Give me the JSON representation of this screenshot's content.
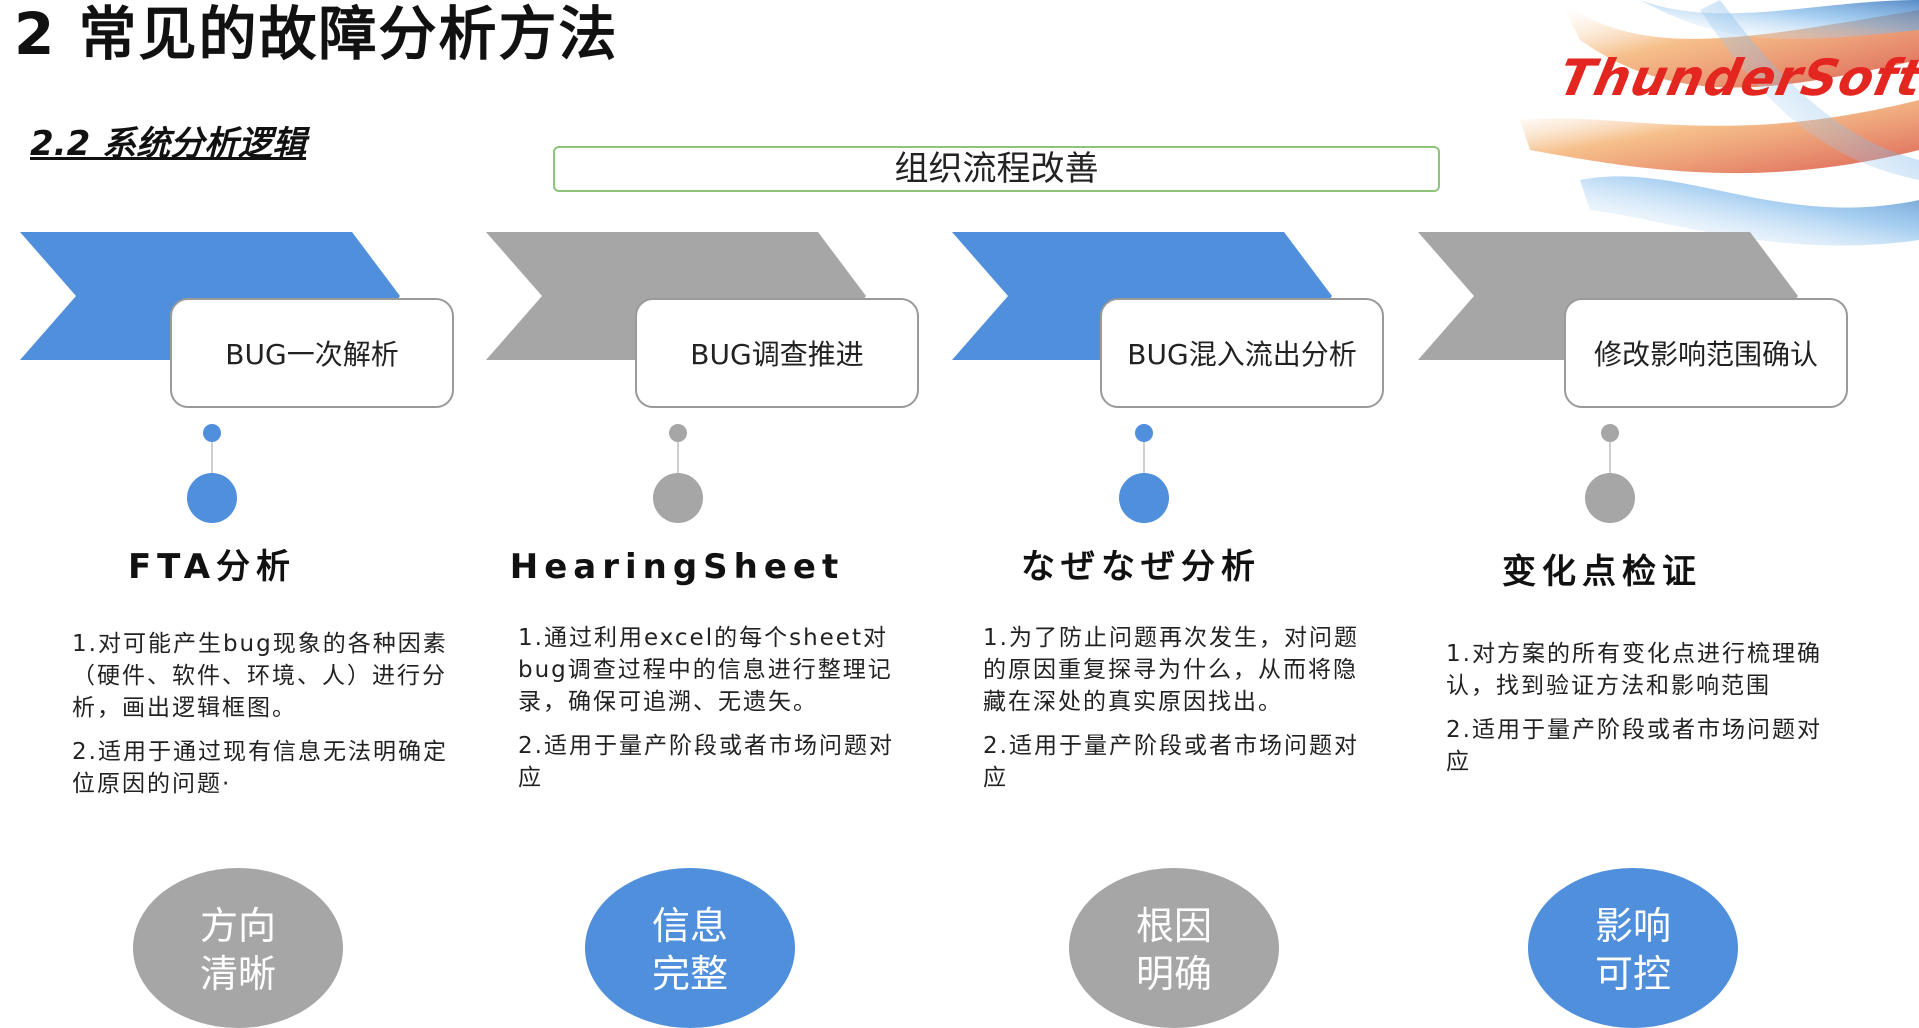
{
  "slide": {
    "title": "2  常见的故障分析方法",
    "subtitle": "2.2 系统分析逻辑",
    "logo_text": "ThunderSoft",
    "org_banner": "组织流程改善"
  },
  "colors": {
    "blue": "#4f8fdc",
    "gray": "#a6a6a6",
    "banner_border": "#8cc47a",
    "logo_red": "#e3261f"
  },
  "stages": [
    {
      "step": "BUG一次解析",
      "method": "FTA分析",
      "desc1": "1.对可能产生bug现象的各种因素（硬件、软件、环境、人）进行分析，画出逻辑框图。",
      "desc2": "2.适用于通过现有信息无法明确定位原因的问题·",
      "result_line1": "方向",
      "result_line2": "清晰",
      "color": "blue",
      "result_color": "gray"
    },
    {
      "step": "BUG调查推进",
      "method": "HearingSheet",
      "desc1": "1.通过利用excel的每个sheet对bug调查过程中的信息进行整理记录，确保可追溯、无遗矢。",
      "desc2": "2.适用于量产阶段或者市场问题对应",
      "result_line1": "信息",
      "result_line2": "完整",
      "color": "gray",
      "result_color": "blue"
    },
    {
      "step": "BUG混入流出分析",
      "method": "なぜなぜ分析",
      "desc1": "1.为了防止问题再次发生，对问题的原因重复探寻为什么，从而将隐藏在深处的真实原因找出。",
      "desc2": "2.适用于量产阶段或者市场问题对应",
      "result_line1": "根因",
      "result_line2": "明确",
      "color": "blue",
      "result_color": "gray"
    },
    {
      "step": "修改影响范围确认",
      "method": "变化点检证",
      "desc1": "1.对方案的所有变化点进行梳理确认，找到验证方法和影响范围",
      "desc2": "2.适用于量产阶段或者市场问题对应",
      "result_line1": "影响",
      "result_line2": "可控",
      "color": "gray",
      "result_color": "blue"
    }
  ]
}
